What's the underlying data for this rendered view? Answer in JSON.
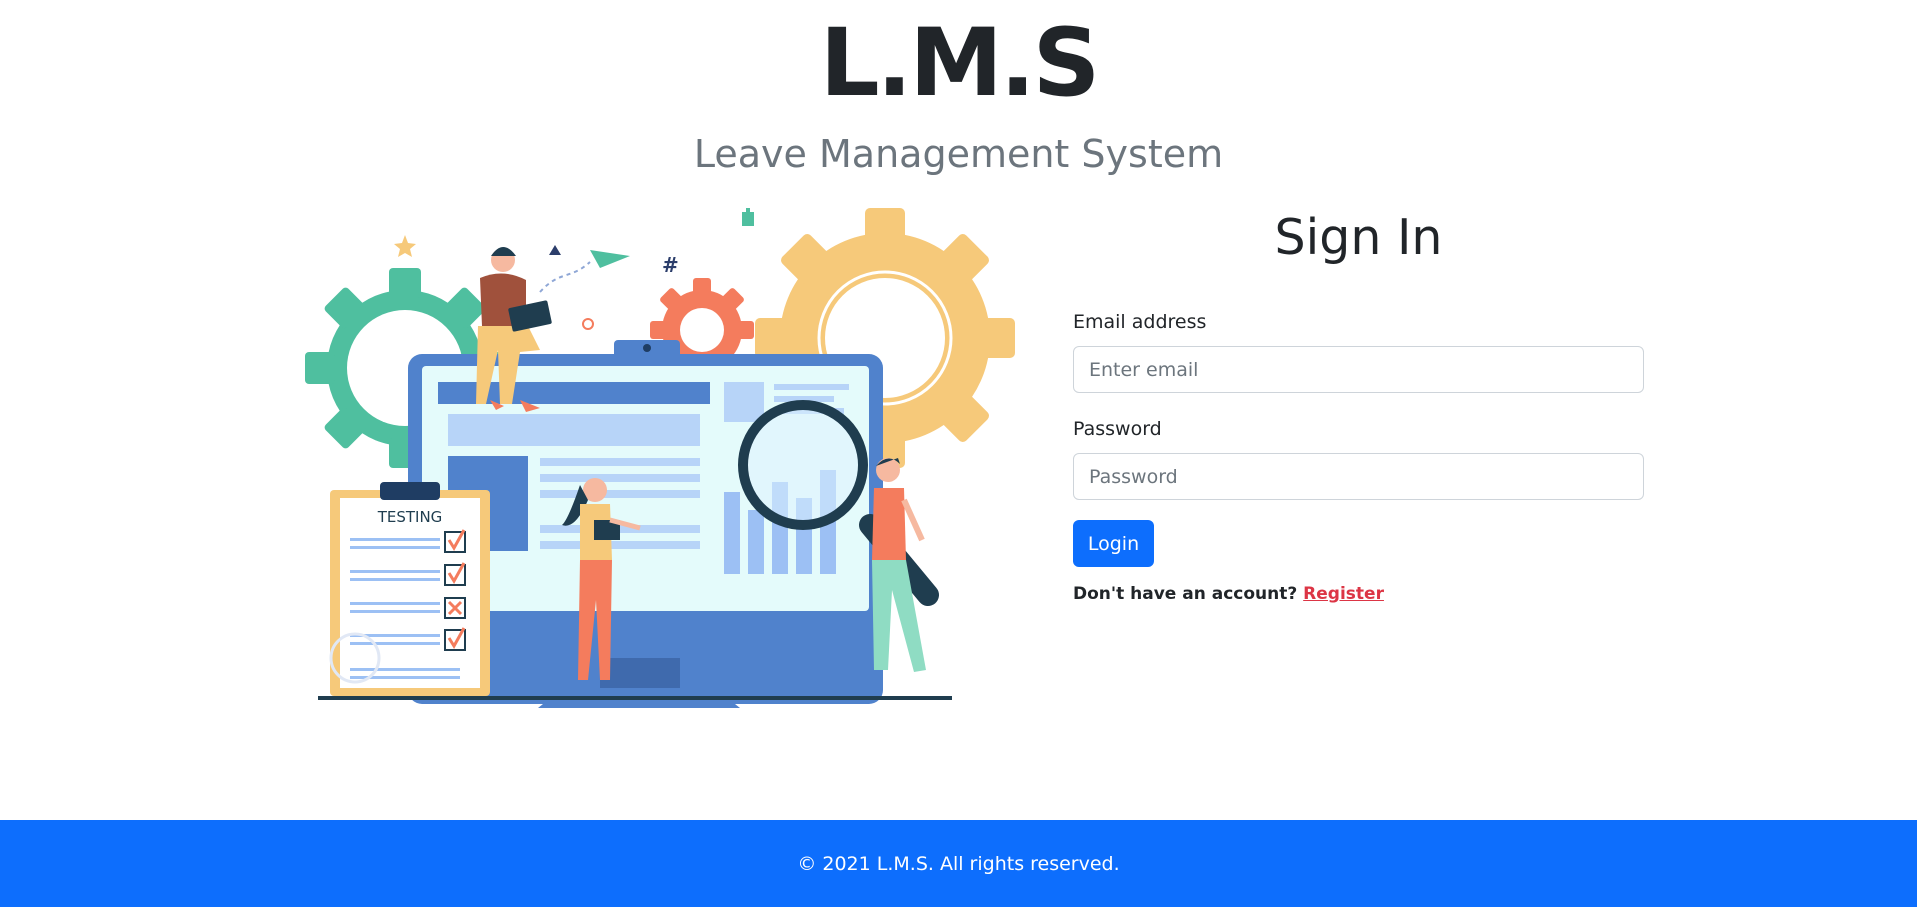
{
  "header": {
    "title": "L.M.S",
    "subtitle": "Leave Management System"
  },
  "illustration": {
    "clipboard_label": "TESTING",
    "hash_glyph": "#"
  },
  "signin": {
    "title": "Sign In",
    "email_label": "Email address",
    "email_placeholder": "Enter email",
    "email_value": "",
    "password_label": "Password",
    "password_placeholder": "Password",
    "password_value": "",
    "login_label": "Login",
    "register_prompt": "Don't have an account?",
    "register_link": "Register"
  },
  "footer": {
    "text": "© 2021 L.M.S. All rights reserved."
  },
  "colors": {
    "primary": "#0d6efd",
    "link_danger": "#dc3545",
    "muted": "#6c757d",
    "dark": "#212529"
  }
}
